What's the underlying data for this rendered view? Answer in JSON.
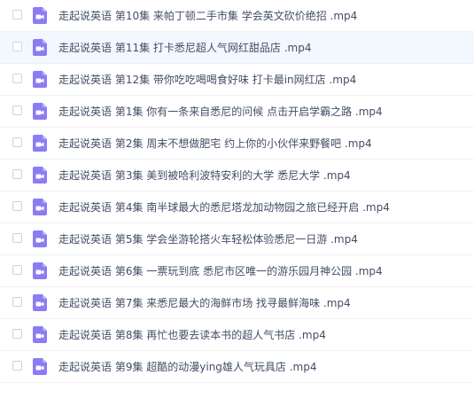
{
  "files": [
    {
      "name": "走起说英语 第10集 来帕丁顿二手市集 学会英文砍价绝招 .mp4",
      "icon": "video-file-icon",
      "hovered": false
    },
    {
      "name": "走起说英语 第11集 打卡悉尼超人气网红甜品店 .mp4",
      "icon": "video-file-icon",
      "hovered": true
    },
    {
      "name": "走起说英语 第12集 带你吃吃喝喝食好味 打卡最in网红店 .mp4",
      "icon": "video-file-icon",
      "hovered": false
    },
    {
      "name": "走起说英语 第1集 你有一条来自悉尼的问候 点击开启学霸之路 .mp4",
      "icon": "video-file-icon",
      "hovered": false
    },
    {
      "name": "走起说英语 第2集 周末不想做肥宅 约上你的小伙伴来野餐吧 .mp4",
      "icon": "video-file-icon",
      "hovered": false
    },
    {
      "name": "走起说英语 第3集 美到被哈利波特安利的大学 悉尼大学 .mp4",
      "icon": "video-file-icon",
      "hovered": false
    },
    {
      "name": "走起说英语 第4集 南半球最大的悉尼塔龙加动物园之旅已经开启 .mp4",
      "icon": "video-file-icon",
      "hovered": false
    },
    {
      "name": "走起说英语 第5集 学会坐游轮搭火车轻松体验悉尼一日游 .mp4",
      "icon": "video-file-icon",
      "hovered": false
    },
    {
      "name": "走起说英语 第6集 一票玩到底 悉尼市区唯一的游乐园月神公园 .mp4",
      "icon": "video-file-icon",
      "hovered": false
    },
    {
      "name": "走起说英语 第7集 来悉尼最大的海鲜市场 找寻最鲜海味 .mp4",
      "icon": "video-file-icon",
      "hovered": false
    },
    {
      "name": "走起说英语 第8集 再忙也要去读本书的超人气书店 .mp4",
      "icon": "video-file-icon",
      "hovered": false
    },
    {
      "name": "走起说英语 第9集 超酷的动漫ying雄人气玩具店 .mp4",
      "icon": "video-file-icon",
      "hovered": false
    }
  ],
  "colors": {
    "icon_purple": "#8b7cf6",
    "text": "#424e67",
    "hover_bg": "#f3f8ff",
    "divider": "#f1f2f5"
  }
}
